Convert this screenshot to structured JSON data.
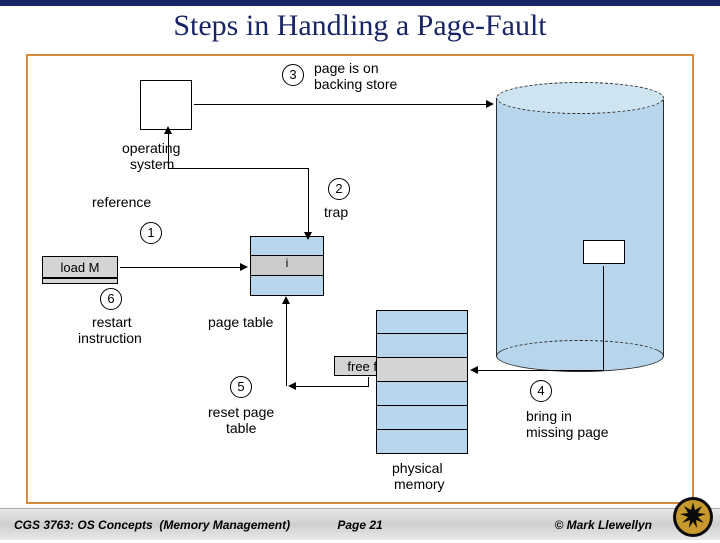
{
  "title": "Steps in Handling a Page-Fault",
  "labels": {
    "pageIsOn": "page is on",
    "backingStore": "backing store",
    "operating": "operating",
    "system": "system",
    "reference": "reference",
    "trap": "trap",
    "loadM": "load M",
    "restart": "restart",
    "instruction": "instruction",
    "pageTable": "page table",
    "resetPage": "reset page",
    "table": "table",
    "freeFrame": "free frame",
    "bringIn": "bring in",
    "missingPage": "missing page",
    "physical": "physical",
    "memory": "memory",
    "i": "i"
  },
  "steps": {
    "s1": "1",
    "s2": "2",
    "s3": "3",
    "s4": "4",
    "s5": "5",
    "s6": "6"
  },
  "footer": {
    "course": "CGS 3763: OS Concepts",
    "topic": "(Memory Management)",
    "page": "Page 21",
    "copyright": "© Mark Llewellyn"
  }
}
